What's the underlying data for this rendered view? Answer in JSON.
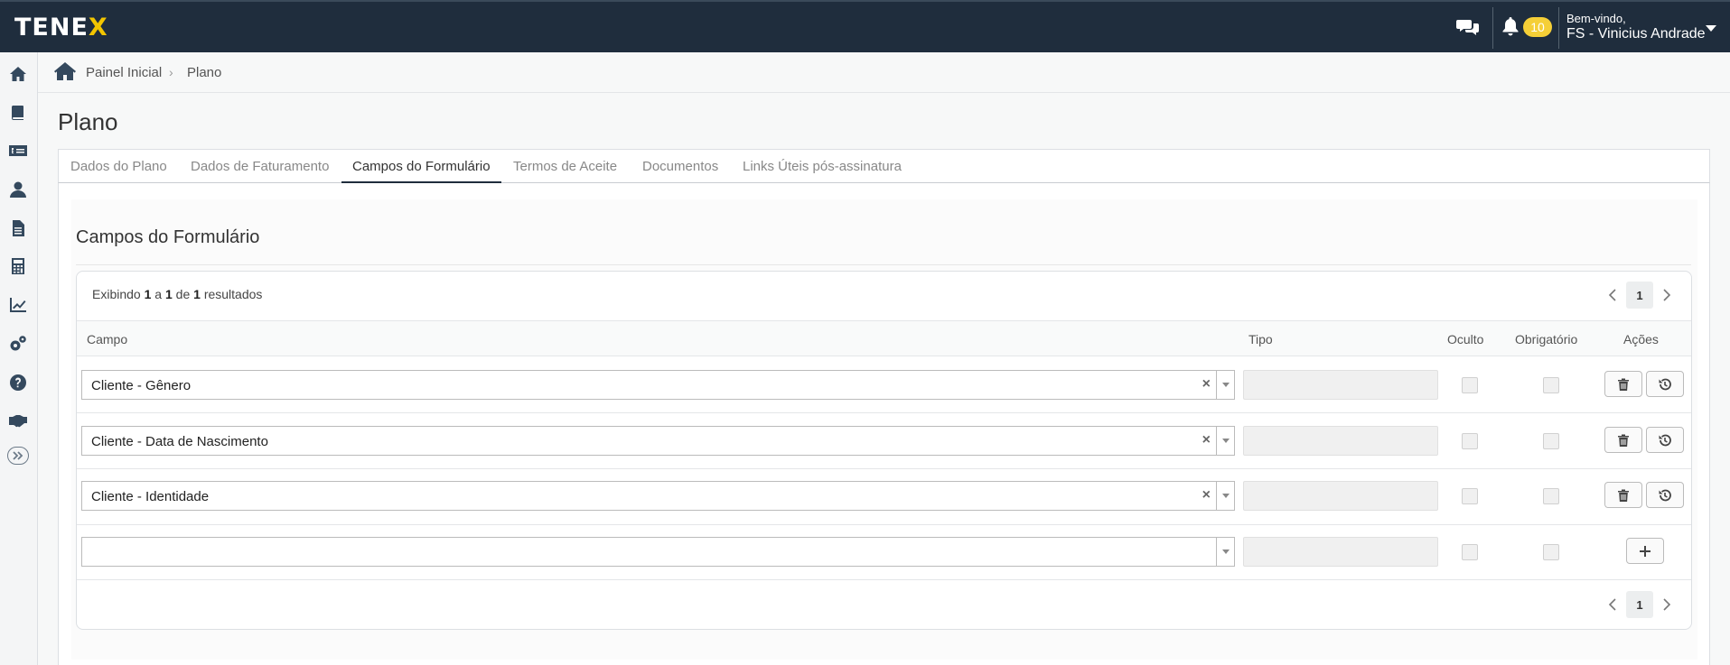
{
  "header": {
    "logo_text_a": "TENE",
    "logo_text_b": "X",
    "notification_count": "10",
    "welcome": "Bem-vindo,",
    "user_name": "FS - Vinicius Andrade"
  },
  "sidebar": {
    "items": [
      "home-icon",
      "book-icon",
      "money-card-icon",
      "user-icon",
      "document-icon",
      "calculator-icon",
      "chart-icon",
      "settings-icon",
      "help-icon",
      "handshake-icon"
    ]
  },
  "breadcrumb": {
    "home": "Painel Inicial",
    "separator": "›",
    "current": "Plano"
  },
  "page": {
    "title": "Plano"
  },
  "tabs": [
    {
      "label": "Dados do Plano"
    },
    {
      "label": "Dados de Faturamento"
    },
    {
      "label": "Campos do Formulário",
      "active": true
    },
    {
      "label": "Termos de Aceite"
    },
    {
      "label": "Documentos"
    },
    {
      "label": "Links Úteis pós-assinatura"
    }
  ],
  "section": {
    "title": "Campos do Formulário",
    "results": {
      "prefix": "Exibindo",
      "from": "1",
      "to_word": "a",
      "to": "1",
      "of_word": "de",
      "total": "1",
      "suffix": "resultados"
    },
    "page_number": "1"
  },
  "table": {
    "columns": {
      "campo": "Campo",
      "tipo": "Tipo",
      "oculto": "Oculto",
      "obrigatorio": "Obrigatório",
      "acoes": "Ações"
    },
    "rows": [
      {
        "campo": "Cliente - Gênero",
        "clear": "×"
      },
      {
        "campo": "Cliente - Data de Nascimento",
        "clear": "×"
      },
      {
        "campo": "Cliente - Identidade",
        "clear": "×"
      }
    ],
    "new_row": {
      "campo": ""
    }
  }
}
